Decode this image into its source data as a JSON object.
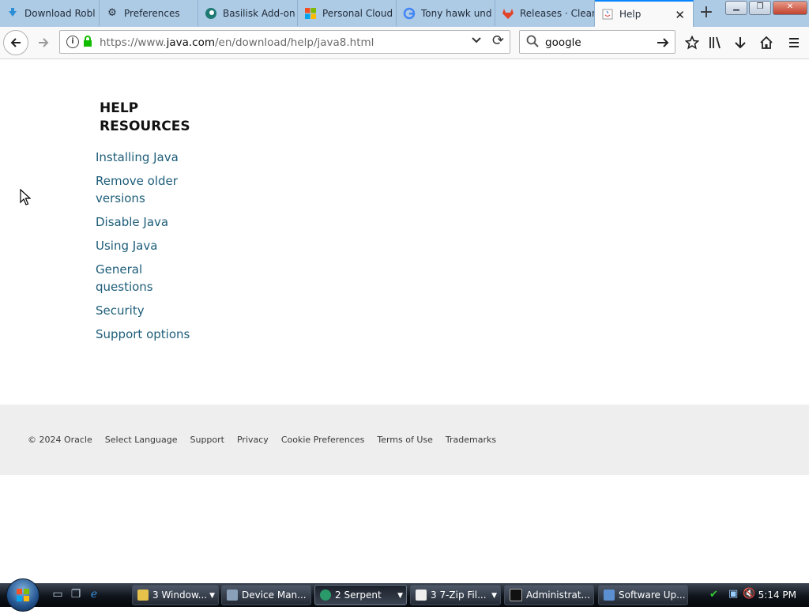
{
  "browser": {
    "tabs": [
      {
        "label": "Download Robl",
        "icon": "download-arrow-icon"
      },
      {
        "label": "Preferences",
        "icon": "gear-icon"
      },
      {
        "label": "Basilisk Add-on",
        "icon": "basilisk-icon"
      },
      {
        "label": "Personal Cloud",
        "icon": "microsoft-icon"
      },
      {
        "label": "Tony hawk und",
        "icon": "google-icon"
      },
      {
        "label": "Releases · Clean",
        "icon": "gitlab-icon"
      },
      {
        "label": "Help",
        "icon": "java-icon"
      }
    ],
    "url_prefix": "https://www.",
    "url_domain": "java.com",
    "url_path": "/en/download/help/java8.html",
    "search_value": "google"
  },
  "page": {
    "heading_line1": "HELP",
    "heading_line2": "RESOURCES",
    "links": [
      {
        "label_line1": "Installing Java",
        "label_line2": ""
      },
      {
        "label_line1": "Remove older",
        "label_line2": "versions"
      },
      {
        "label_line1": "Disable Java",
        "label_line2": ""
      },
      {
        "label_line1": "Using Java",
        "label_line2": ""
      },
      {
        "label_line1": "General",
        "label_line2": "questions"
      },
      {
        "label_line1": "Security",
        "label_line2": ""
      },
      {
        "label_line1": "Support options",
        "label_line2": ""
      }
    ],
    "footer": {
      "copyright": "© 2024 Oracle",
      "items": [
        "Select Language",
        "Support",
        "Privacy",
        "Cookie Preferences",
        "Terms of Use",
        "Trademarks"
      ]
    }
  },
  "taskbar": {
    "buttons": [
      {
        "label": "3 Window..."
      },
      {
        "label": "Device Man..."
      },
      {
        "label": "2 Serpent"
      },
      {
        "label": "3 7-Zip Fil..."
      },
      {
        "label": "Administrat..."
      },
      {
        "label": "Software Up..."
      }
    ],
    "clock": "5:14 PM"
  },
  "colors": {
    "link": "#1d5d79",
    "tab_accent": "#0a84ff",
    "footer_bg": "#eeeeee"
  }
}
